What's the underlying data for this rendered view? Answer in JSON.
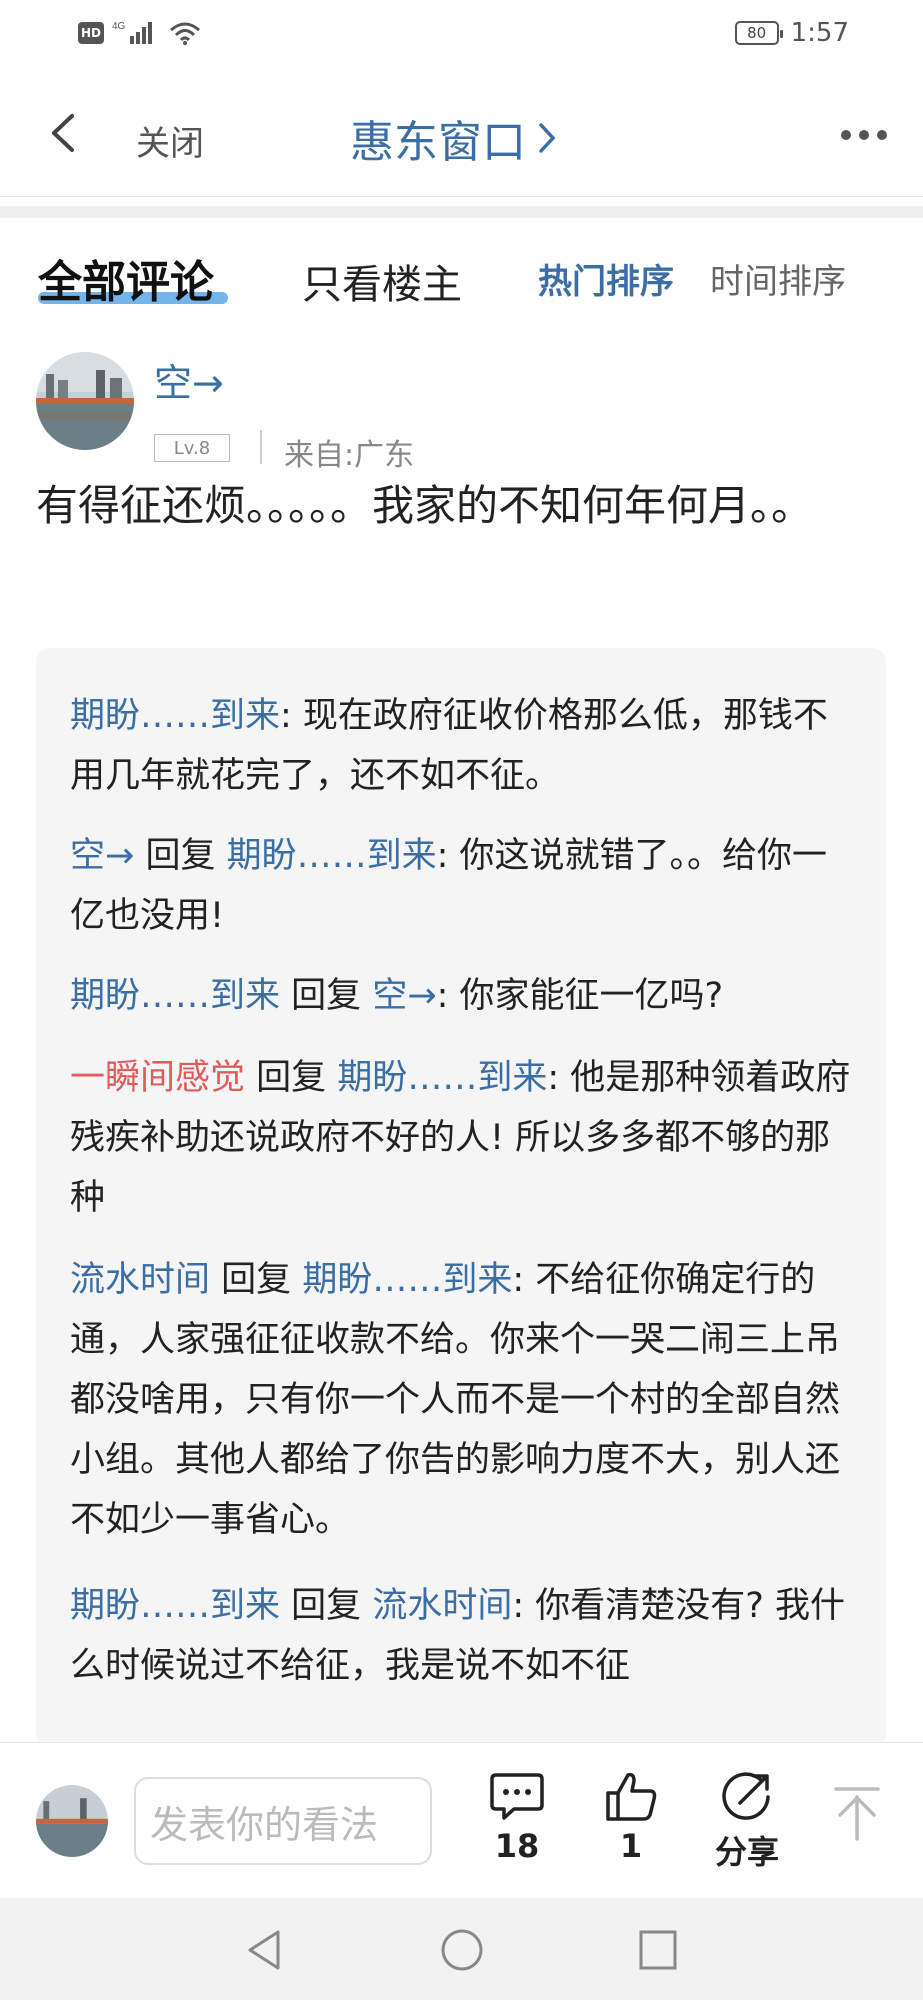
{
  "status_bar": {
    "hd": "HD",
    "network": "4G",
    "battery": "80",
    "time": "1:57"
  },
  "nav": {
    "close_label": "关闭",
    "title": "惠东窗口",
    "more_icon": "more-dots-icon"
  },
  "tabs": {
    "all_comments": "全部评论",
    "owner_only": "只看楼主",
    "sort_hot": "热门排序",
    "sort_time": "时间排序"
  },
  "post": {
    "username": "空→",
    "level": "Lv.8",
    "from": "来自:广东",
    "content": "有得征还烦。。。。。我家的不知何年何月。。"
  },
  "replies": [
    {
      "author": "期盼……到来",
      "author_color": "blue",
      "reply_word": "",
      "target": "",
      "text": ": 现在政府征收价格那么低，那钱不用几年就花完了，还不如不征。"
    },
    {
      "author": "空→",
      "author_color": "blue",
      "reply_word": "回复",
      "target": "期盼……到来",
      "text": ": 你这说就错了。。给你一亿也没用!"
    },
    {
      "author": "期盼……到来",
      "author_color": "blue",
      "reply_word": "回复",
      "target": "空→",
      "text": ": 你家能征一亿吗?"
    },
    {
      "author": "一瞬间感觉",
      "author_color": "red",
      "reply_word": "回复",
      "target": "期盼……到来",
      "text": ": 他是那种领着政府残疾补助还说政府不好的人! 所以多多都不够的那种"
    },
    {
      "author": "流水时间",
      "author_color": "blue",
      "reply_word": "回复",
      "target": "期盼……到来",
      "text": ": 不给征你确定行的通，人家强征征收款不给。你来个一哭二闹三上吊都没啥用，只有你一个人而不是一个村的全部自然小组。其他人都给了你告的影响力度不大，别人还不如少一事省心。"
    },
    {
      "author": "期盼……到来",
      "author_color": "blue",
      "reply_word": "回复",
      "target": "流水时间",
      "text": ": 你看清楚没有? 我什么时候说过不给征，我是说不如不征"
    }
  ],
  "bottom": {
    "input_placeholder": "发表你的看法",
    "comment_count": "18",
    "like_count": "1",
    "share_label": "分享"
  },
  "colors": {
    "link_blue": "#3a6ea5",
    "name_red": "#e25b5b",
    "underline_blue": "#5aa7e6"
  }
}
